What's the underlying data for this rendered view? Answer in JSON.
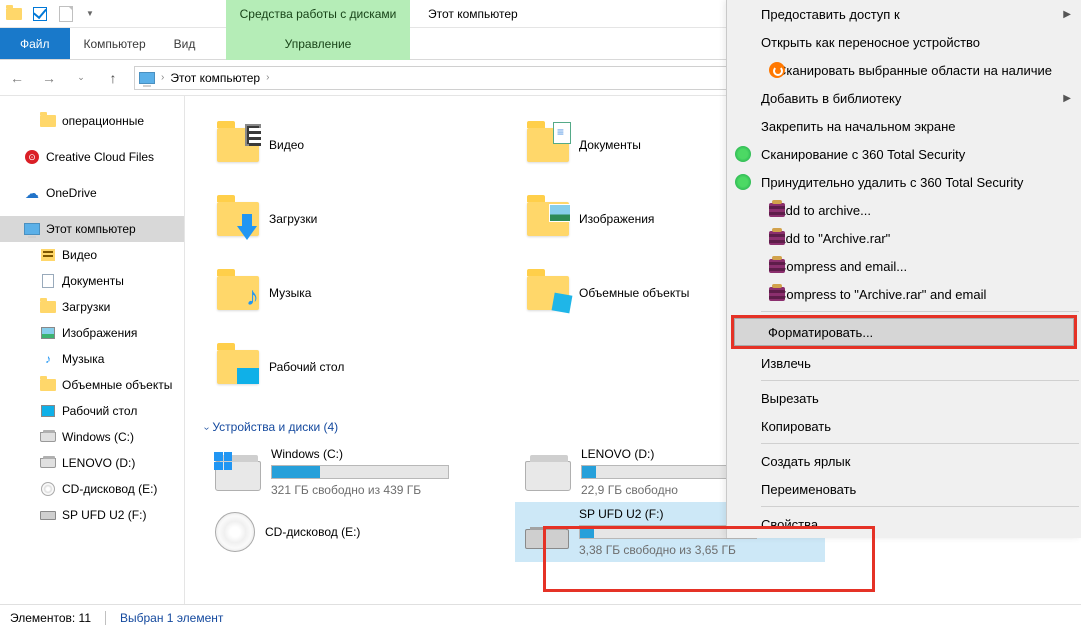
{
  "titlebar": {
    "contextual_tab": "Средства работы с дисками",
    "window_title": "Этот компьютер"
  },
  "ribbon": {
    "file": "Файл",
    "computer": "Компьютер",
    "view": "Вид",
    "manage": "Управление"
  },
  "breadcrumb": {
    "root": "Этот компьютер"
  },
  "sidebar": {
    "items": [
      {
        "label": "операционные",
        "icon": "folder",
        "lvl": 2
      },
      {
        "label": "Creative Cloud Files",
        "icon": "cc",
        "lvl": 1,
        "gap": true
      },
      {
        "label": "OneDrive",
        "icon": "onedrive",
        "lvl": 1,
        "gap": true
      },
      {
        "label": "Этот компьютер",
        "icon": "pc",
        "lvl": 1,
        "sel": true,
        "gap": true
      },
      {
        "label": "Видео",
        "icon": "film",
        "lvl": 2
      },
      {
        "label": "Документы",
        "icon": "docf",
        "lvl": 2
      },
      {
        "label": "Загрузки",
        "icon": "dl",
        "lvl": 2
      },
      {
        "label": "Изображения",
        "icon": "pic",
        "lvl": 2
      },
      {
        "label": "Музыка",
        "icon": "mus",
        "lvl": 2
      },
      {
        "label": "Объемные объекты",
        "icon": "3d",
        "lvl": 2
      },
      {
        "label": "Рабочий стол",
        "icon": "desk",
        "lvl": 2
      },
      {
        "label": "Windows (C:)",
        "icon": "drive",
        "lvl": 2
      },
      {
        "label": "LENOVO (D:)",
        "icon": "drive",
        "lvl": 2
      },
      {
        "label": "CD-дисковод (E:)",
        "icon": "cd",
        "lvl": 2
      },
      {
        "label": "SP UFD U2 (F:)",
        "icon": "usb",
        "lvl": 2
      }
    ]
  },
  "groups": {
    "folders": {
      "items": [
        {
          "label": "Видео",
          "ov": "film"
        },
        {
          "label": "Документы",
          "ov": "doc"
        },
        {
          "label": "Загрузки",
          "ov": "dl"
        },
        {
          "label": "Изображения",
          "ov": "pic"
        },
        {
          "label": "Музыка",
          "ov": "mus"
        },
        {
          "label": "Объемные объекты",
          "ov": "3d"
        },
        {
          "label": "Рабочий стол",
          "ov": "desk"
        }
      ]
    },
    "drives": {
      "header": "Устройства и диски (4)",
      "items": [
        {
          "label": "Windows (C:)",
          "sub": "321 ГБ свободно из 439 ГБ",
          "fill": 27,
          "kind": "win"
        },
        {
          "label": "LENOVO (D:)",
          "sub": "22,9 ГБ свободно",
          "fill": 8,
          "kind": "hdd"
        },
        {
          "label": "CD-дисковод (E:)",
          "sub": "",
          "fill": -1,
          "kind": "cd"
        },
        {
          "label": "SP UFD U2 (F:)",
          "sub": "3,38 ГБ свободно из 3,65 ГБ",
          "fill": 8,
          "kind": "usb",
          "sel": true
        }
      ]
    }
  },
  "context_menu": {
    "items": [
      {
        "label": "Предоставить доступ к",
        "sub": true
      },
      {
        "label": "Открыть как переносное устройство"
      },
      {
        "label": "Сканировать выбранные области на наличие",
        "icon": "avast"
      },
      {
        "label": "Добавить в библиотеку",
        "sub": true
      },
      {
        "label": "Закрепить на начальном экране"
      },
      {
        "label": "Сканирование с 360 Total Security",
        "icon": "ts360"
      },
      {
        "label": "Принудительно удалить с  360 Total Security",
        "icon": "ts360"
      },
      {
        "label": "Add to archive...",
        "icon": "winrar"
      },
      {
        "label": "Add to \"Archive.rar\"",
        "icon": "winrar"
      },
      {
        "label": "Compress and email...",
        "icon": "winrar"
      },
      {
        "label": "Compress to \"Archive.rar\" and email",
        "icon": "winrar"
      },
      {
        "sep": true
      },
      {
        "label": "Форматировать...",
        "hov": true,
        "redbox": true
      },
      {
        "label": "Извлечь"
      },
      {
        "sep": true
      },
      {
        "label": "Вырезать"
      },
      {
        "label": "Копировать"
      },
      {
        "sep": true
      },
      {
        "label": "Создать ярлык"
      },
      {
        "label": "Переименовать"
      },
      {
        "sep": true
      },
      {
        "label": "Свойства"
      }
    ]
  },
  "status": {
    "count": "Элементов: 11",
    "selection": "Выбран 1 элемент"
  }
}
